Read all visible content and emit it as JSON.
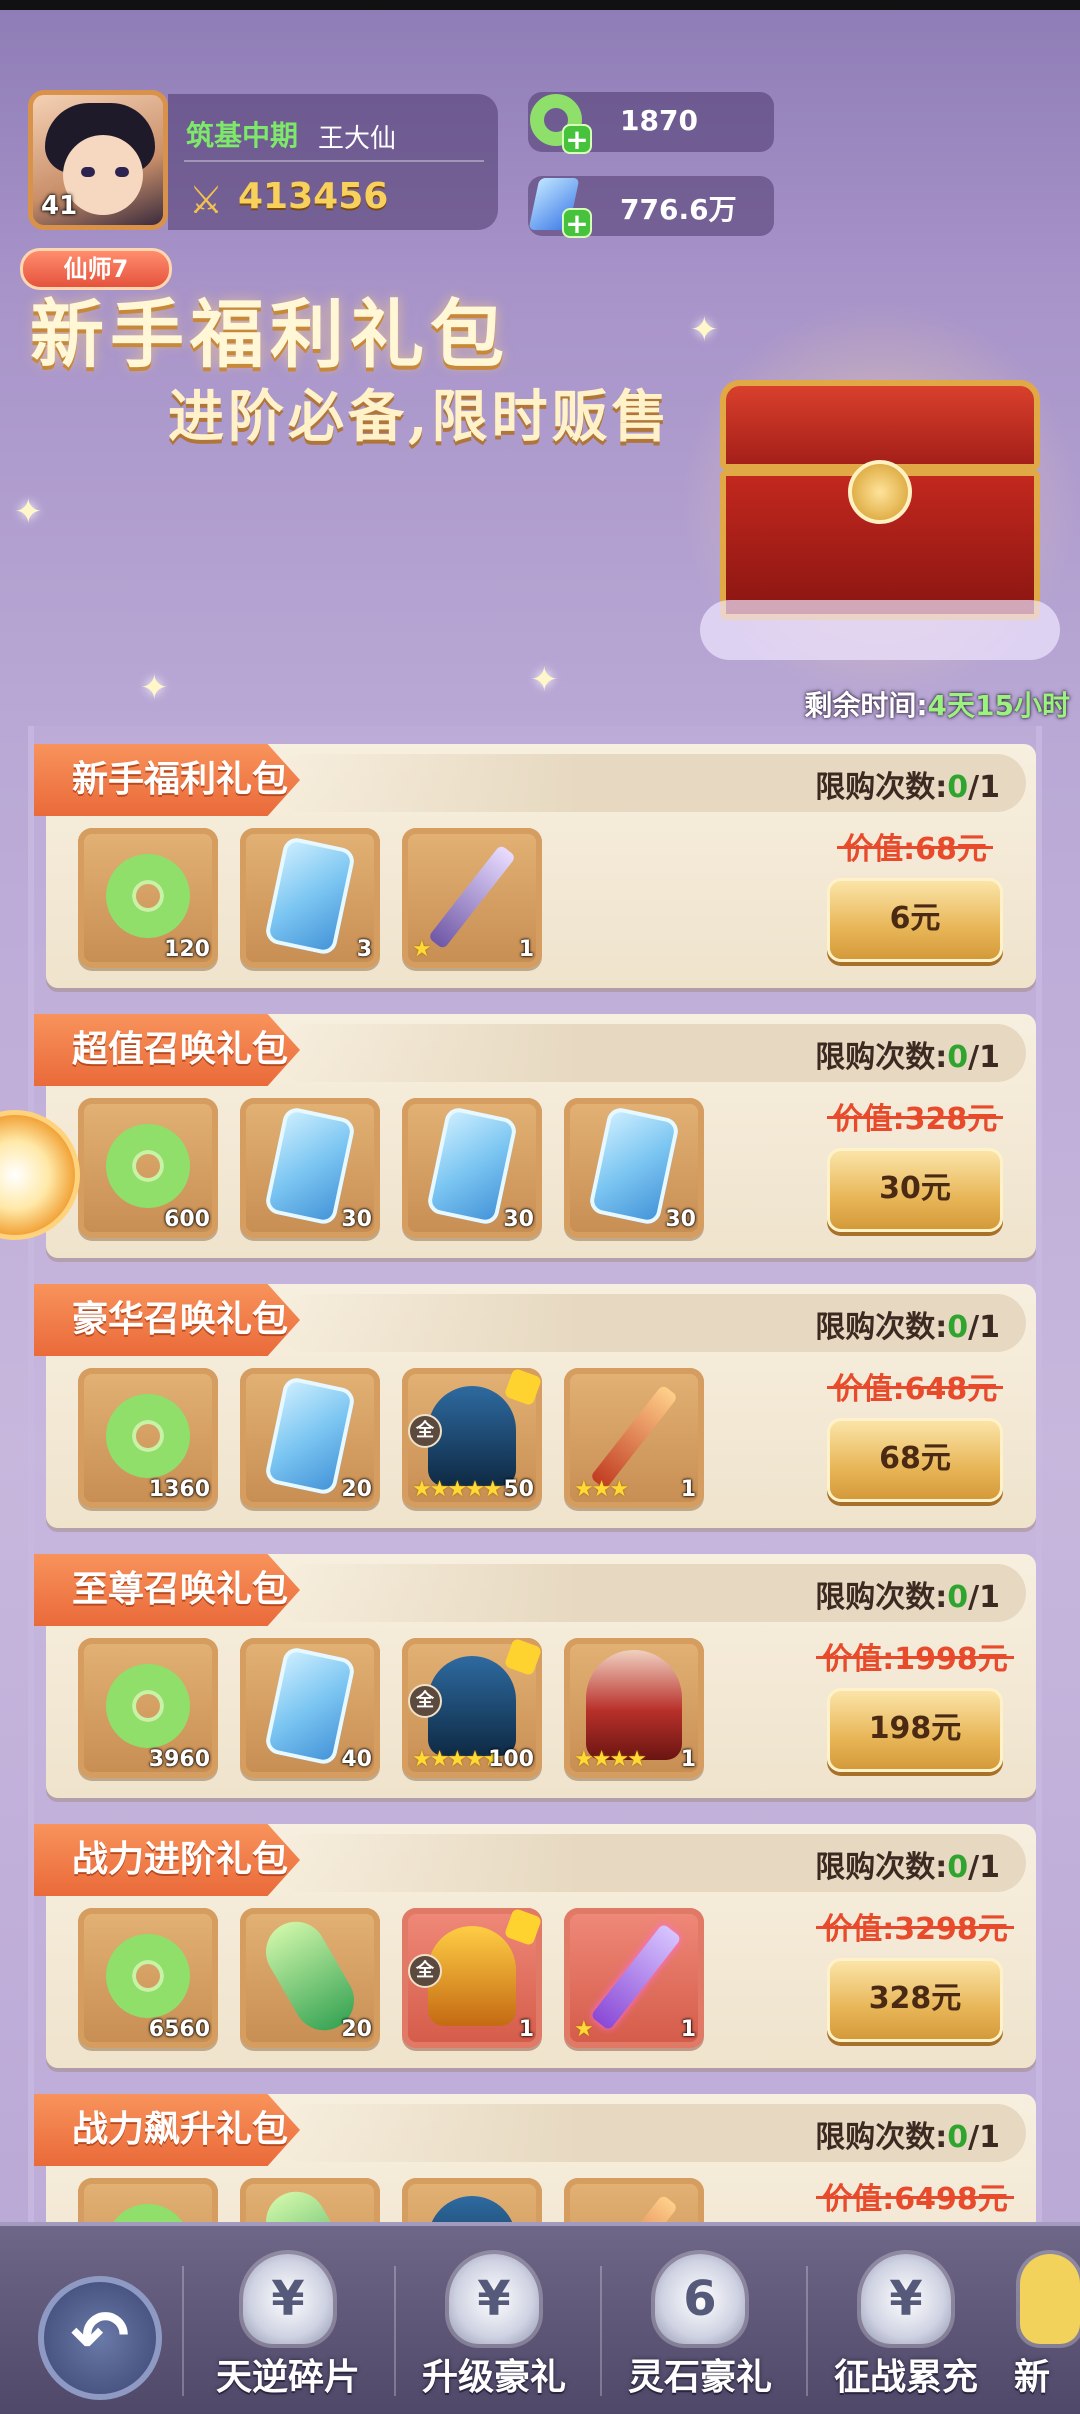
{
  "header": {
    "level": "41",
    "realm": "筑基中期",
    "player_name": "王大仙",
    "power": "413456",
    "currencies": [
      {
        "icon": "jade-icon",
        "value": "1870"
      },
      {
        "icon": "spirit-stone-icon",
        "value": "776.6万"
      }
    ],
    "vip": "仙师7"
  },
  "banner": {
    "title": "新手福利礼包",
    "subtitle": "进阶必备,限时贩售",
    "timer_label": "剩余时间:",
    "timer_value": "4天15小时"
  },
  "packs": [
    {
      "title": "新手福利礼包",
      "limit_label": "限购次数:",
      "limit_count": "0",
      "limit_total": "/1",
      "old_price": "价值:68元",
      "price": "6元",
      "items": [
        {
          "name": "jade",
          "qty": "120"
        },
        {
          "name": "scroll",
          "qty": "3"
        },
        {
          "name": "sword",
          "qty": "1",
          "stars": "★"
        }
      ]
    },
    {
      "title": "超值召唤礼包",
      "limit_label": "限购次数:",
      "limit_count": "0",
      "limit_total": "/1",
      "old_price": "价值:328元",
      "price": "30元",
      "items": [
        {
          "name": "jade",
          "qty": "600"
        },
        {
          "name": "scroll",
          "qty": "30"
        },
        {
          "name": "scroll",
          "qty": "30"
        },
        {
          "name": "scroll",
          "qty": "30"
        }
      ]
    },
    {
      "title": "豪华召唤礼包",
      "limit_label": "限购次数:",
      "limit_count": "0",
      "limit_total": "/1",
      "old_price": "价值:648元",
      "price": "68元",
      "items": [
        {
          "name": "jade",
          "qty": "1360"
        },
        {
          "name": "scroll",
          "qty": "20"
        },
        {
          "name": "fragment",
          "qty": "50",
          "stars": "★★★★★",
          "tag": "全"
        },
        {
          "name": "sword-red",
          "qty": "1",
          "stars": "★★★"
        }
      ]
    },
    {
      "title": "至尊召唤礼包",
      "limit_label": "限购次数:",
      "limit_count": "0",
      "limit_total": "/1",
      "old_price": "价值:1998元",
      "price": "198元",
      "items": [
        {
          "name": "jade",
          "qty": "3960"
        },
        {
          "name": "scroll",
          "qty": "40"
        },
        {
          "name": "fragment",
          "qty": "100",
          "stars": "★★★★★",
          "tag": "全"
        },
        {
          "name": "hero",
          "qty": "1",
          "stars": "★★★★"
        }
      ]
    },
    {
      "title": "战力进阶礼包",
      "limit_label": "限购次数:",
      "limit_count": "0",
      "limit_total": "/1",
      "old_price": "价值:3298元",
      "price": "328元",
      "items": [
        {
          "name": "jade",
          "qty": "6560"
        },
        {
          "name": "leaf",
          "qty": "20"
        },
        {
          "name": "fragment-gold",
          "qty": "1",
          "tag": "全"
        },
        {
          "name": "sword-purple",
          "qty": "1",
          "stars": "★"
        }
      ]
    },
    {
      "title": "战力飙升礼包",
      "limit_label": "限购次数:",
      "limit_count": "0",
      "limit_total": "/1",
      "old_price": "价值:6498元",
      "price": "",
      "items": [
        {
          "name": "jade",
          "qty": ""
        },
        {
          "name": "leaf",
          "qty": ""
        },
        {
          "name": "fragment",
          "qty": ""
        },
        {
          "name": "sword-red",
          "qty": ""
        }
      ]
    }
  ],
  "bottom_nav": {
    "back_icon": "back-arrow-icon",
    "items": [
      {
        "label": "天逆碎片",
        "icon": "money-bag-icon"
      },
      {
        "label": "升级豪礼",
        "icon": "money-bag-icon"
      },
      {
        "label": "灵石豪礼",
        "icon": "six-icon"
      },
      {
        "label": "征战累充",
        "icon": "money-bag-icon"
      },
      {
        "label": "新",
        "icon": "partial-icon"
      }
    ]
  },
  "colors": {
    "accent_orange": "#ea6a3a",
    "limit_green": "#2fa52f",
    "old_price_red": "#e74b2c",
    "timer_green": "#9cf27e"
  }
}
